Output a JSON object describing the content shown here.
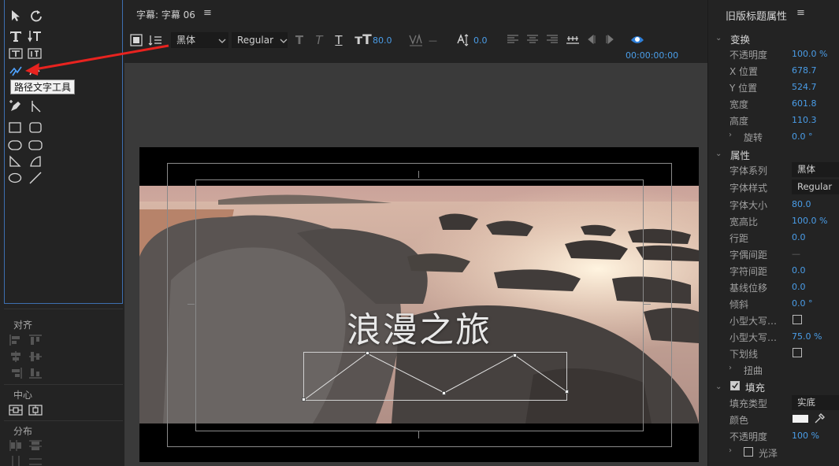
{
  "tools": {
    "tooltip": "路径文字工具",
    "sections": {
      "align": "对齐",
      "center": "中心",
      "distribute": "分布"
    }
  },
  "center": {
    "tab_label": "字幕: 字幕 06",
    "tab_menu": "≡",
    "toolbar": {
      "font_family": "黑体",
      "font_style": "Regular",
      "font_size": "80.0",
      "kerning": "—",
      "baseline": "0.0"
    },
    "timecode": "00:00:00:00",
    "title_text": "浪漫之旅"
  },
  "props": {
    "title": "旧版标题属性",
    "menu": "≡",
    "sections": {
      "transform": "变换",
      "properties": "属性",
      "fill": "填充"
    },
    "transform": {
      "opacity_label": "不透明度",
      "opacity": "100.0 %",
      "x_label": "X 位置",
      "x": "678.7",
      "y_label": "Y 位置",
      "y": "524.7",
      "width_label": "宽度",
      "width": "601.8",
      "height_label": "高度",
      "height": "110.3",
      "rotation_label": "旋转",
      "rotation": "0.0 °"
    },
    "properties": {
      "font_family_label": "字体系列",
      "font_family": "黑体",
      "font_style_label": "字体样式",
      "font_style": "Regular",
      "font_size_label": "字体大小",
      "font_size": "80.0",
      "aspect_label": "宽高比",
      "aspect": "100.0 %",
      "leading_label": "行距",
      "leading": "0.0",
      "kerning_label": "字偶间距",
      "kerning": "—",
      "tracking_label": "字符间距",
      "tracking": "0.0",
      "baseline_label": "基线位移",
      "baseline": "0.0",
      "slant_label": "倾斜",
      "slant": "0.0 °",
      "smallcaps_label": "小型大写…",
      "smallcaps_size_label": "小型大写…",
      "smallcaps_size": "75.0 %",
      "underline_label": "下划线",
      "distort_label": "扭曲"
    },
    "fill": {
      "fill_type_label": "填充类型",
      "fill_type": "实底",
      "color_label": "颜色",
      "opacity_label": "不透明度",
      "opacity": "100 %",
      "sheen_label": "光泽"
    }
  }
}
